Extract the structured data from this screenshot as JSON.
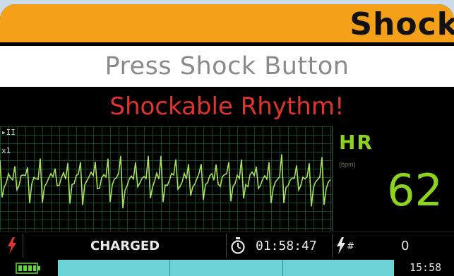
{
  "banner": {
    "title": "Shock"
  },
  "prompt": {
    "text": "Press Shock Button"
  },
  "alarm": {
    "text": "Shockable Rhythm!"
  },
  "ecg": {
    "lead": "II",
    "gain": "x1"
  },
  "heart_rate": {
    "label": "HR",
    "unit": "(bpm)",
    "value": "62"
  },
  "status": {
    "charge_state": "CHARGED",
    "elapsed_time": "01:58:47",
    "shock_count": "0"
  },
  "footer": {
    "time": "15:58"
  },
  "colors": {
    "banner": "#f5a019",
    "alarm_text": "#e2342e",
    "hr_text": "#8cd21e",
    "ecg_trace": "#a8e05a",
    "shock_icon": "#e2342e",
    "battery": "#5fd23c",
    "footer_bar": "#6cd2d6"
  },
  "icons": {
    "shock": "lightning-bolt",
    "timer": "stopwatch",
    "shock_count": "lightning-hash",
    "battery": "battery-full"
  }
}
